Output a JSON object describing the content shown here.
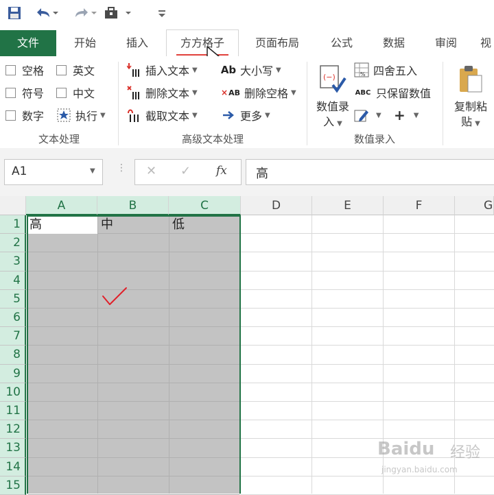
{
  "ribbon_tabs": {
    "file": "文件",
    "home": "开始",
    "insert": "插入",
    "fangfangezi": "方方格子",
    "page_layout": "页面布局",
    "formulas": "公式",
    "data": "数据",
    "review": "审阅",
    "view": "视"
  },
  "text_processing": {
    "space": "空格",
    "english": "英文",
    "symbol": "符号",
    "chinese": "中文",
    "number": "数字",
    "execute": "执行",
    "group_label": "文本处理"
  },
  "advanced_text": {
    "insert_text": "插入文本",
    "delete_text": "删除文本",
    "extract_text": "截取文本",
    "case": "大小写",
    "delete_spaces": "删除空格",
    "more": "更多",
    "group_label": "高级文本处理",
    "case_icon": "Ab",
    "delete_spaces_icon": "AB"
  },
  "numeric_entry": {
    "value_entry_line1": "数值录",
    "value_entry_line2": "入",
    "round": "四舍五入",
    "keep_values": "只保留数值",
    "plus": "+",
    "group_label": "数值录入",
    "keep_values_icon": "ABC"
  },
  "clipboard": {
    "copy_paste_line1": "复制粘",
    "copy_paste_line2": "贴"
  },
  "formula_bar": {
    "name_box": "A1",
    "cancel": "✕",
    "confirm": "✓",
    "fx": "fx",
    "content": "高"
  },
  "columns": [
    "A",
    "B",
    "C",
    "D",
    "E",
    "F",
    "G"
  ],
  "rows": [
    "1",
    "2",
    "3",
    "4",
    "5",
    "6",
    "7",
    "8",
    "9",
    "10",
    "11",
    "12",
    "13",
    "14",
    "15"
  ],
  "cells": {
    "A1": "高",
    "B1": "中",
    "C1": "低"
  },
  "watermark": {
    "brand": "Baidu",
    "brand_cn": "经验",
    "url": "jingyan.baidu.com"
  },
  "colors": {
    "excel_green": "#217346",
    "selection_gray": "#c3c3c3",
    "header_selected": "#d3ede0",
    "check_red": "#e0202a"
  }
}
